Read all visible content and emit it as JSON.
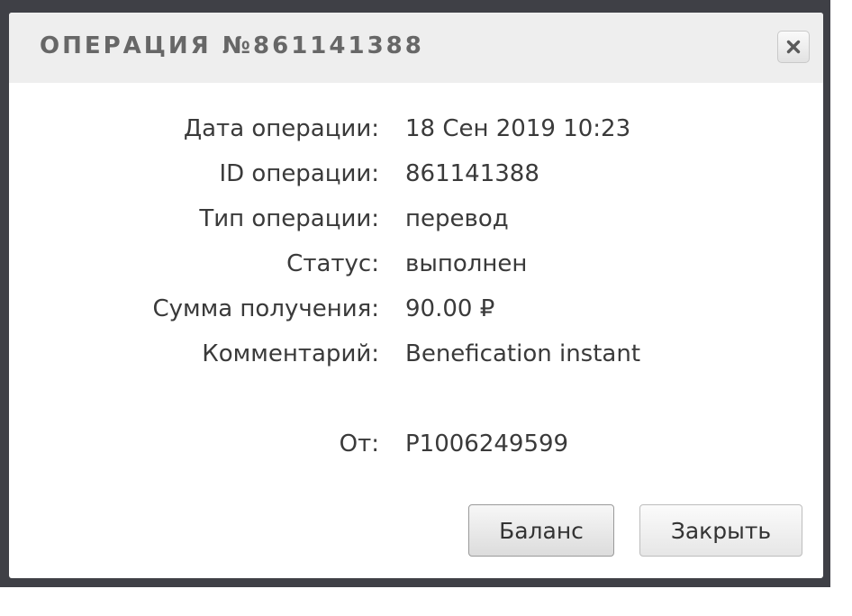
{
  "dialog": {
    "title": "ОПЕРАЦИЯ №861141388",
    "close_icon": "close-icon"
  },
  "details": {
    "date": {
      "label": "Дата операции:",
      "value": "18 Сен 2019 10:23"
    },
    "id": {
      "label": "ID операции:",
      "value": "861141388"
    },
    "type": {
      "label": "Тип операции:",
      "value": "перевод"
    },
    "status": {
      "label": "Статус:",
      "value": "выполнен"
    },
    "amount": {
      "label": "Сумма получения:",
      "value": "90.00 ₽"
    },
    "comment": {
      "label": "Комментарий:",
      "value": "Benefication instant"
    },
    "from": {
      "label": "От:",
      "value": "P1006249599"
    }
  },
  "buttons": {
    "balance": "Баланс",
    "close": "Закрыть"
  }
}
